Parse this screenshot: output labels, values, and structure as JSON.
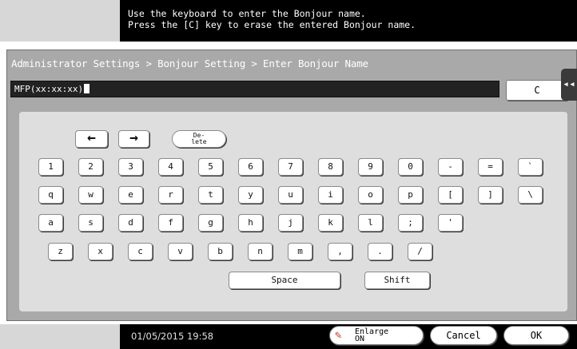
{
  "message": {
    "line1": "Use the keyboard to enter the Bonjour name.",
    "line2": "Press the [C] key to erase the entered Bonjour name."
  },
  "breadcrumb": "Administrator Settings > Bonjour Setting > Enter Bonjour Name",
  "input": {
    "value": "MFP(xx:xx:xx)"
  },
  "clear_label": "C",
  "keyboard": {
    "arrows": [
      "←",
      "→"
    ],
    "delete_label_1": "De-",
    "delete_label_2": "lete",
    "row1": [
      "1",
      "2",
      "3",
      "4",
      "5",
      "6",
      "7",
      "8",
      "9",
      "0",
      "-",
      "=",
      "`"
    ],
    "row2": [
      "q",
      "w",
      "e",
      "r",
      "t",
      "y",
      "u",
      "i",
      "o",
      "p",
      "[",
      "]",
      "\\"
    ],
    "row3": [
      "a",
      "s",
      "d",
      "f",
      "g",
      "h",
      "j",
      "k",
      "l",
      ";",
      "'"
    ],
    "row4": [
      "z",
      "x",
      "c",
      "v",
      "b",
      "n",
      "m",
      ",",
      ".",
      "/"
    ],
    "space_label": "Space",
    "shift_label": "Shift"
  },
  "footer": {
    "datetime": "01/05/2015  19:58",
    "enlarge_line1": "Enlarge",
    "enlarge_line2": "ON",
    "cancel_label": "Cancel",
    "ok_label": "OK"
  },
  "icons": {
    "enlarge": "enlarge-display-icon",
    "side_tab": "collapse-arrow-icon"
  }
}
